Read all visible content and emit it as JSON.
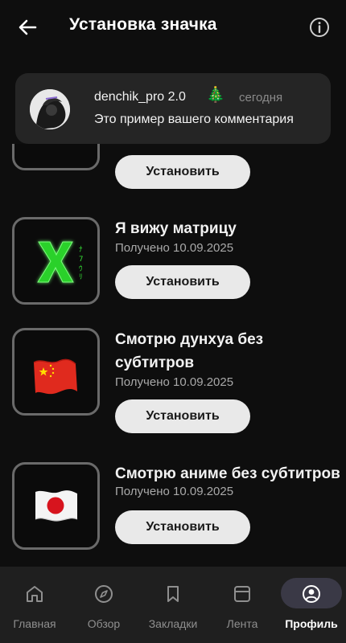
{
  "header": {
    "title": "Установка значка",
    "back_icon": "arrow-left-icon",
    "info_icon": "info-icon"
  },
  "preview": {
    "username": "denchik_pro 2.0",
    "badge_emoji": "🎄",
    "time": "сегодня",
    "comment": "Это пример вашего комментария"
  },
  "badges": [
    {
      "install_label": "Установить"
    },
    {
      "name": "Я вижу матрицу",
      "received": "Получено 10.09.2025",
      "install_label": "Установить",
      "icon": "matrix-x-icon"
    },
    {
      "name_line1": "Смотрю дунхуа без",
      "name_line2": "субтитров",
      "received": "Получено 10.09.2025",
      "install_label": "Установить",
      "icon": "china-flag-icon"
    },
    {
      "name": "Смотрю аниме без субтитров",
      "received": "Получено 10.09.2025",
      "install_label": "Установить",
      "icon": "japan-flag-icon"
    }
  ],
  "nav": {
    "items": [
      {
        "label": "Главная",
        "icon": "home-icon"
      },
      {
        "label": "Обзор",
        "icon": "compass-icon"
      },
      {
        "label": "Закладки",
        "icon": "bookmark-icon"
      },
      {
        "label": "Лента",
        "icon": "feed-icon"
      },
      {
        "label": "Профиль",
        "icon": "profile-icon",
        "active": true
      }
    ]
  },
  "colors": {
    "background": "#0e0e0e",
    "card": "#252525",
    "button": "#e9e9e9",
    "nav_bg": "#1f1f1f",
    "nav_active_pill": "#3a3946"
  }
}
